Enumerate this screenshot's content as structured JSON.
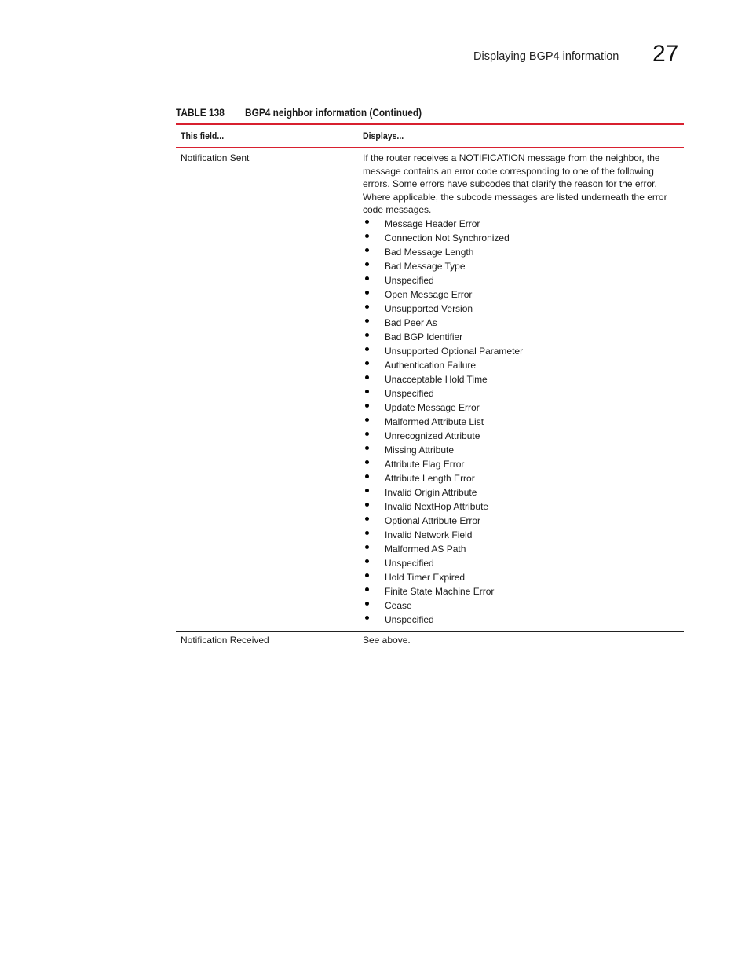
{
  "header": {
    "section_title": "Displaying BGP4 information",
    "chapter_number": "27"
  },
  "table": {
    "caption_label": "TABLE 138",
    "caption_title": "BGP4 neighbor information  (Continued)",
    "columns": [
      "This field...",
      "Displays..."
    ],
    "rows": [
      {
        "field": "Notification Sent",
        "description": "If the router receives a NOTIFICATION message from the neighbor, the message contains an error code corresponding to one of the following errors.  Some errors have subcodes that clarify the reason for the error. Where applicable, the subcode messages are listed underneath the error code messages.",
        "bullets": [
          "Message Header Error",
          "Connection Not Synchronized",
          "Bad Message Length",
          "Bad Message Type",
          "Unspecified",
          "Open Message Error",
          "Unsupported Version",
          "Bad Peer As",
          "Bad BGP Identifier",
          "Unsupported Optional Parameter",
          "Authentication Failure",
          "Unacceptable Hold Time",
          "Unspecified",
          "Update Message Error",
          "Malformed Attribute List",
          "Unrecognized Attribute",
          "Missing Attribute",
          "Attribute Flag Error",
          "Attribute Length Error",
          "Invalid Origin Attribute",
          "Invalid NextHop Attribute",
          "Optional Attribute Error",
          "Invalid Network Field",
          "Malformed AS Path",
          "Unspecified",
          "Hold Timer Expired",
          "Finite State Machine Error",
          "Cease",
          "Unspecified"
        ]
      },
      {
        "field": "Notification Received",
        "description": "See above."
      }
    ]
  }
}
